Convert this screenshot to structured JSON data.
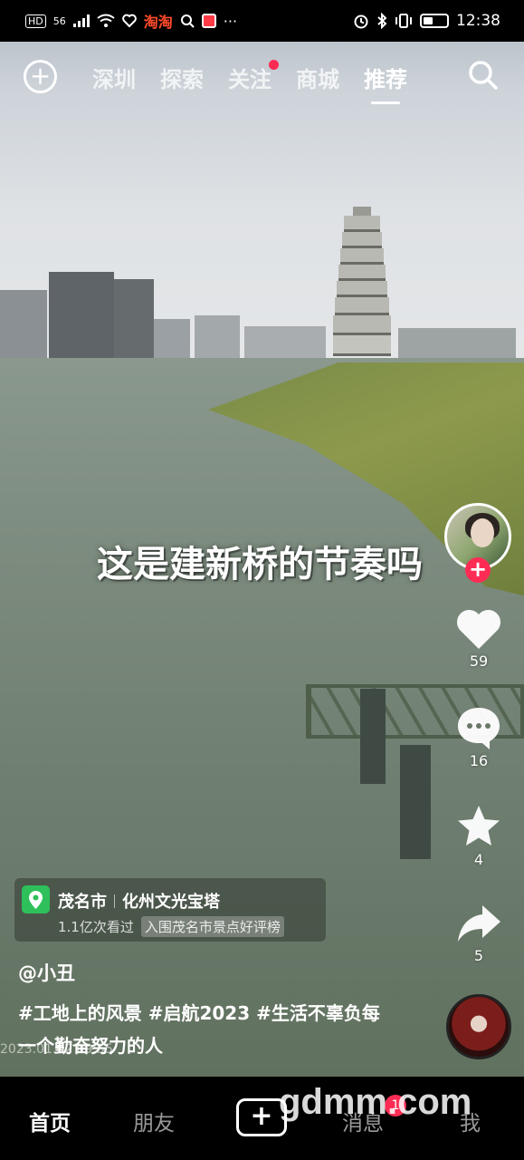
{
  "status_bar": {
    "hd": "HD",
    "signal": "56",
    "taobao": "淘淘",
    "more": "···",
    "time": "12:38"
  },
  "top_nav": {
    "tabs": [
      {
        "label": "深圳"
      },
      {
        "label": "探索"
      },
      {
        "label": "关注"
      },
      {
        "label": "商城"
      },
      {
        "label": "推荐"
      }
    ],
    "active_tab": "推荐"
  },
  "video": {
    "caption": "这是建新桥的节奏吗"
  },
  "actions": {
    "likes": "59",
    "comments": "16",
    "favorites": "4",
    "shares": "5"
  },
  "location": {
    "city": "茂名市",
    "place": "化州文光宝塔",
    "views": "1.1亿次看过",
    "rank": "入围茂名市景点好评榜"
  },
  "post": {
    "author": "@小丑",
    "description": "#工地上的风景 #启航2023 #生活不辜负每一个勤奋努力的人",
    "timestamp": "2023.01.02 09:55"
  },
  "bottom_nav": {
    "home": "首页",
    "friends": "朋友",
    "create": "+",
    "messages": "消息",
    "me": "我",
    "message_badge": "1"
  },
  "watermark": "gdmm.com",
  "colors": {
    "accent_red": "#fe2c55",
    "location_green": "#2ec05a"
  }
}
